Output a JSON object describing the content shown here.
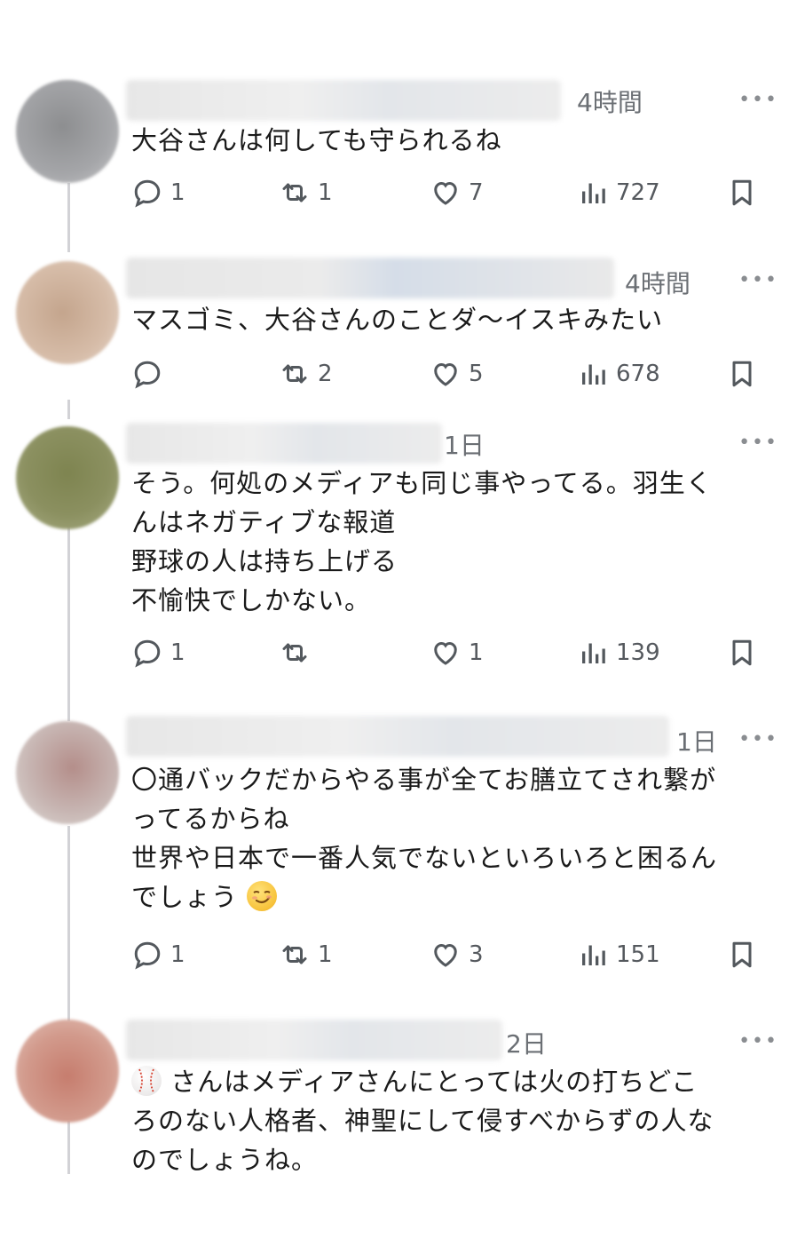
{
  "posts": [
    {
      "time": "4時間",
      "lines": [
        "大谷さんは何しても守られるね"
      ],
      "reply_count": "1",
      "repost_count": "1",
      "like_count": "7",
      "view_count": "727"
    },
    {
      "time": "4時間",
      "lines": [
        "マスゴミ、大谷さんのことダ～イスキみたい"
      ],
      "reply_count": "",
      "repost_count": "2",
      "like_count": "5",
      "view_count": "678"
    },
    {
      "time": "1日",
      "lines": [
        "そう。何処のメディアも同じ事やってる。羽生く",
        "んはネガティブな報道",
        "野球の人は持ち上げる",
        "不愉快でしかない。"
      ],
      "reply_count": "1",
      "repost_count": "",
      "like_count": "1",
      "view_count": "139"
    },
    {
      "time": "1日",
      "lines": [
        "〇通バックだからやる事が全てお膳立てされ繋が",
        "ってるからね",
        "世界や日本で一番人気でないといろいろと困るん",
        "でしょう"
      ],
      "reply_count": "1",
      "repost_count": "1",
      "like_count": "3",
      "view_count": "151"
    },
    {
      "time": "2日",
      "lines": [
        "さんはメディアさんにとっては火の打ちどこ",
        "ろのない人格者、神聖にして侵すべからずの人な",
        "のでしょうね。"
      ]
    }
  ],
  "more_label": "•••",
  "colors": {
    "text": "#1a1a1a",
    "meta": "#6b6f74",
    "icon": "#53585d"
  }
}
